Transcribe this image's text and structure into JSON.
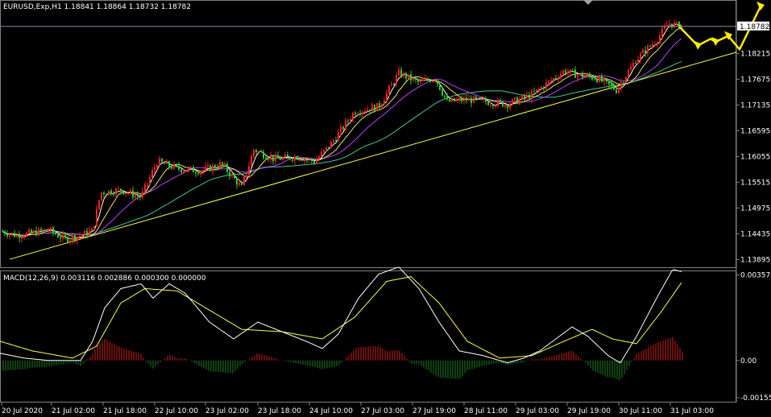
{
  "main_chart": {
    "header": "EURUSD,Exp,H1  1.18841 1.18864 1.18732 1.18782",
    "current_price_label": "1.18782",
    "price_ticks": [
      "1.18215",
      "1.17675",
      "1.17135",
      "1.16595",
      "1.16055",
      "1.15515",
      "1.14975",
      "1.14435",
      "1.13895"
    ],
    "price_range": [
      1.138,
      1.192
    ]
  },
  "macd_panel": {
    "header": "MACD(12,26,9) 0.003116 0.002886 0.000300 0.000000",
    "ticks": [
      "0.003575",
      "0.00",
      "-0.001552"
    ],
    "range": [
      -0.00162,
      0.00362
    ]
  },
  "time_axis": {
    "labels": [
      "20 Jul 2020",
      "21 Jul 02:00",
      "21 Jul 18:00",
      "22 Jul 10:00",
      "23 Jul 02:00",
      "23 Jul 18:00",
      "24 Jul 10:00",
      "27 Jul 03:00",
      "27 Jul 19:00",
      "28 Jul 11:00",
      "29 Jul 03:00",
      "29 Jul 19:00",
      "30 Jul 11:00",
      "31 Jul 03:00"
    ]
  },
  "colors": {
    "background": "#000000",
    "bull_candle": "#ff2020",
    "bear_candle": "#2ecc2e",
    "ma_fast": "#ffffff",
    "ma_mid": "#e8e860",
    "ma_slow": "#c040ff",
    "ma_long": "#40c8a0",
    "trendline": "#ffff40",
    "forecast_arrow": "#ffee00",
    "macd_line": "#ffffff",
    "signal_line": "#ffff40",
    "hist_pos": "#d02020",
    "hist_neg": "#208020"
  },
  "chart_data": {
    "type": "candlestick",
    "symbol": "EURUSD,Exp",
    "timeframe": "H1",
    "ohlc_last": {
      "open": 1.18841,
      "high": 1.18864,
      "low": 1.18732,
      "close": 1.18782
    },
    "close_path": [
      [
        0,
        1.145
      ],
      [
        20,
        1.144
      ],
      [
        40,
        1.1445
      ],
      [
        60,
        1.1452
      ],
      [
        80,
        1.1432
      ],
      [
        100,
        1.144
      ],
      [
        115,
        1.145
      ],
      [
        125,
        1.153
      ],
      [
        150,
        1.1535
      ],
      [
        175,
        1.152
      ],
      [
        195,
        1.1595
      ],
      [
        220,
        1.158
      ],
      [
        250,
        1.1575
      ],
      [
        275,
        1.159
      ],
      [
        300,
        1.154
      ],
      [
        315,
        1.162
      ],
      [
        340,
        1.16
      ],
      [
        370,
        1.1605
      ],
      [
        390,
        1.1595
      ],
      [
        410,
        1.163
      ],
      [
        440,
        1.17
      ],
      [
        470,
        1.171
      ],
      [
        495,
        1.178
      ],
      [
        520,
        1.176
      ],
      [
        540,
        1.177
      ],
      [
        555,
        1.172
      ],
      [
        580,
        1.1725
      ],
      [
        605,
        1.172
      ],
      [
        630,
        1.1715
      ],
      [
        660,
        1.1735
      ],
      [
        680,
        1.176
      ],
      [
        700,
        1.1785
      ],
      [
        720,
        1.1775
      ],
      [
        740,
        1.177
      ],
      [
        765,
        1.1745
      ],
      [
        790,
        1.181
      ],
      [
        815,
        1.185
      ],
      [
        830,
        1.1885
      ],
      [
        840,
        1.188
      ],
      [
        847,
        1.18782
      ]
    ],
    "macd_series": {
      "macd": [
        [
          0,
          0.0003
        ],
        [
          30,
          0.0001
        ],
        [
          60,
          0.0
        ],
        [
          100,
          0.0
        ],
        [
          115,
          0.0008
        ],
        [
          130,
          0.0022
        ],
        [
          150,
          0.003
        ],
        [
          175,
          0.0032
        ],
        [
          190,
          0.0026
        ],
        [
          210,
          0.0032
        ],
        [
          230,
          0.0028
        ],
        [
          260,
          0.0016
        ],
        [
          290,
          0.0009
        ],
        [
          320,
          0.0016
        ],
        [
          350,
          0.0012
        ],
        [
          380,
          0.0008
        ],
        [
          400,
          0.0005
        ],
        [
          420,
          0.0011
        ],
        [
          445,
          0.0026
        ],
        [
          470,
          0.0036
        ],
        [
          495,
          0.0039
        ],
        [
          520,
          0.003
        ],
        [
          545,
          0.0016
        ],
        [
          570,
          0.0004
        ],
        [
          600,
          0.0002
        ],
        [
          630,
          -0.0001
        ],
        [
          650,
          0.0001
        ],
        [
          670,
          0.0004
        ],
        [
          690,
          0.0009
        ],
        [
          710,
          0.0014
        ],
        [
          730,
          0.001
        ],
        [
          755,
          0.0002
        ],
        [
          770,
          -0.0001
        ],
        [
          790,
          0.001
        ],
        [
          815,
          0.0026
        ],
        [
          835,
          0.0038
        ],
        [
          847,
          0.0037
        ]
      ],
      "signal": [
        [
          0,
          0.0008
        ],
        [
          40,
          0.0004
        ],
        [
          90,
          0.0001
        ],
        [
          120,
          0.0006
        ],
        [
          150,
          0.0024
        ],
        [
          180,
          0.003
        ],
        [
          220,
          0.0029
        ],
        [
          260,
          0.0021
        ],
        [
          300,
          0.0013
        ],
        [
          350,
          0.0012
        ],
        [
          400,
          0.0009
        ],
        [
          440,
          0.0018
        ],
        [
          480,
          0.0033
        ],
        [
          510,
          0.0035
        ],
        [
          545,
          0.0024
        ],
        [
          580,
          0.0008
        ],
        [
          620,
          0.0001
        ],
        [
          660,
          0.0002
        ],
        [
          700,
          0.0008
        ],
        [
          735,
          0.0013
        ],
        [
          760,
          0.0009
        ],
        [
          790,
          0.0007
        ],
        [
          820,
          0.002
        ],
        [
          847,
          0.0033
        ]
      ]
    }
  }
}
